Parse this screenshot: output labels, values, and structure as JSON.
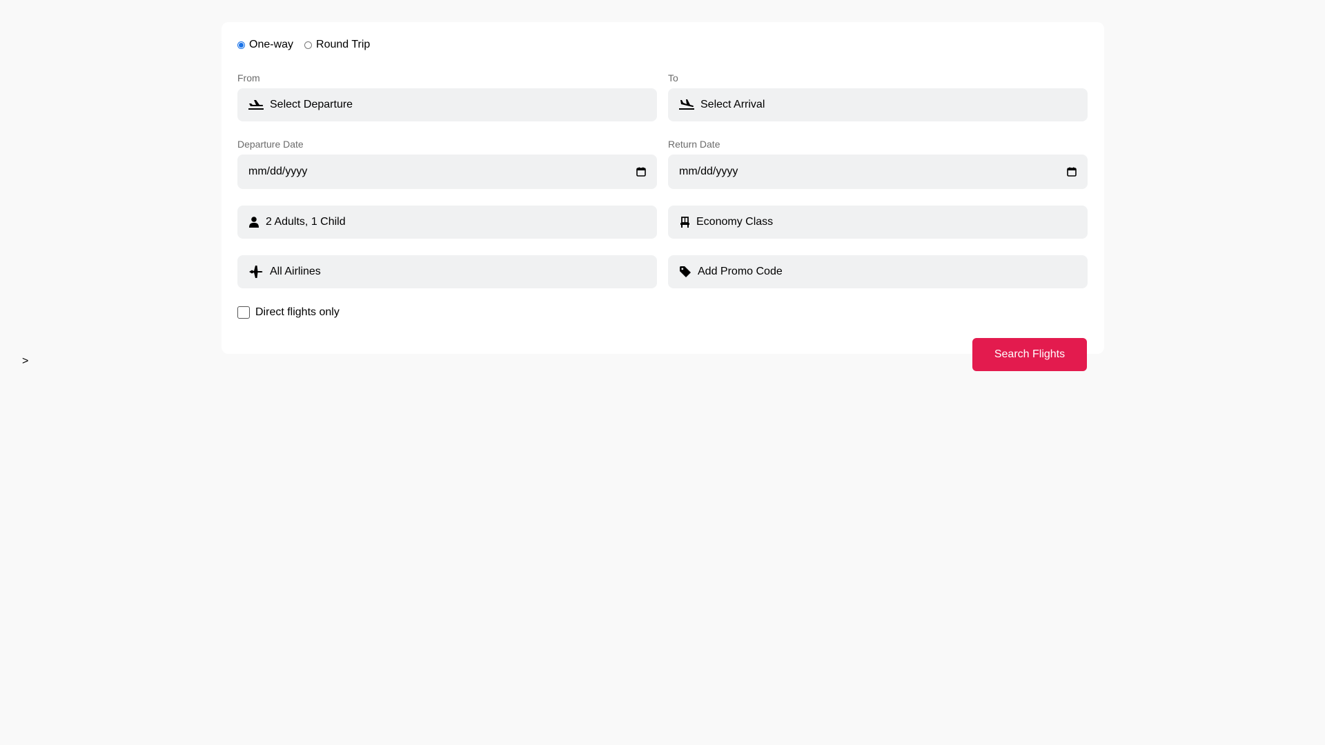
{
  "stray_text": ">",
  "trip_type": {
    "options": [
      {
        "label": "One-way",
        "selected": true
      },
      {
        "label": "Round Trip",
        "selected": false
      }
    ]
  },
  "from": {
    "label": "From",
    "value": "Select Departure",
    "icon": "plane-departure-icon"
  },
  "to": {
    "label": "To",
    "value": "Select Arrival",
    "icon": "plane-arrival-icon"
  },
  "departure_date": {
    "label": "Departure Date",
    "value": "mm/dd/yyyy",
    "icon": "calendar-icon"
  },
  "return_date": {
    "label": "Return Date",
    "value": "mm/dd/yyyy",
    "icon": "calendar-icon"
  },
  "passengers": {
    "value": "2 Adults, 1 Child",
    "icon": "user-icon"
  },
  "cabin_class": {
    "value": "Economy Class",
    "icon": "seat-icon"
  },
  "airlines": {
    "value": "All Airlines",
    "icon": "plane-icon"
  },
  "promo": {
    "value": "Add Promo Code",
    "icon": "tag-icon"
  },
  "direct_only": {
    "label": "Direct flights only",
    "checked": false
  },
  "search_button": {
    "label": "Search Flights"
  },
  "colors": {
    "accent": "#e31b4e",
    "radio_selected": "#1a73e8",
    "field_bg": "#f0f1f2",
    "page_bg": "#f9f9f9"
  }
}
